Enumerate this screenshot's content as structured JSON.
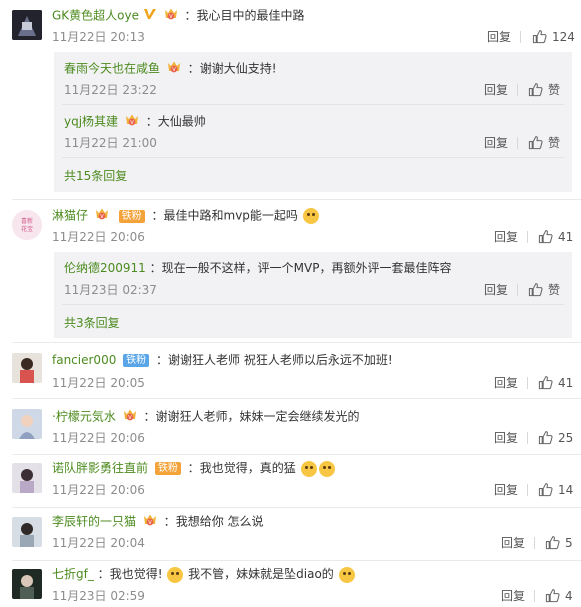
{
  "comments": [
    {
      "user": "GK黄色超人oye",
      "text": "我心目中的最佳中路",
      "time": "11月22日 20:13",
      "reply_label": "回复",
      "likes": "124",
      "replies": [
        {
          "user": "春雨今天也在咸鱼",
          "text": "谢谢大仙支持!",
          "time": "11月22日 23:22",
          "reply_label": "回复",
          "like_label": "赞"
        },
        {
          "user": "yqj杨其建",
          "text": "大仙最帅",
          "time": "11月22日 21:00",
          "reply_label": "回复",
          "like_label": "赞"
        }
      ],
      "more": "共15条回复"
    },
    {
      "user": "淋猫仔",
      "fan_badge": "铁粉",
      "text": "最佳中路和mvp能一起吗",
      "time": "11月22日 20:06",
      "reply_label": "回复",
      "likes": "41",
      "replies": [
        {
          "user": "伦纳德200911",
          "text": "现在一般不这样，评一个MVP，再额外评一套最佳阵容",
          "time": "11月23日 02:37",
          "reply_label": "回复",
          "like_label": "赞"
        }
      ],
      "more": "共3条回复"
    },
    {
      "user": "fancier000",
      "fan_badge": "铁粉",
      "text": "谢谢狂人老师 祝狂人老师以后永远不加班!",
      "time": "11月22日 20:05",
      "reply_label": "回复",
      "likes": "41"
    },
    {
      "user": "·柠檬元気水",
      "text": "谢谢狂人老师，妹妹一定会继续发光的",
      "time": "11月22日 20:06",
      "reply_label": "回复",
      "likes": "25"
    },
    {
      "user": "诺队胖影勇往直前",
      "fan_badge": "铁粉",
      "text": "我也觉得，真的猛",
      "time": "11月22日 20:06",
      "reply_label": "回复",
      "likes": "14"
    },
    {
      "user": "李辰轩的一只猫",
      "text": "我想给你 怎么说",
      "time": "11月22日 20:04",
      "reply_label": "回复",
      "likes": "5"
    },
    {
      "user": "七折gf_",
      "text": "我也觉得!",
      "text2": "我不管，妹妹就是坠diao的",
      "time": "11月23日 02:59",
      "reply_label": "回复",
      "likes": "4"
    }
  ],
  "colors": {
    "username": "#4c8b1f",
    "meta": "#8c8c8c",
    "sub_bg": "#f2f2f5",
    "fan_badge": "#f3a33a"
  }
}
